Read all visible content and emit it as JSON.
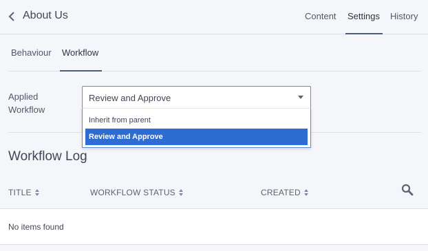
{
  "header": {
    "title": "About Us",
    "tabs": [
      {
        "label": "Content"
      },
      {
        "label": "Settings"
      },
      {
        "label": "History"
      }
    ],
    "active_tab": "Settings"
  },
  "settings_tabs": {
    "tabs": [
      {
        "label": "Behaviour"
      },
      {
        "label": "Workflow"
      }
    ],
    "active_tab": "Workflow"
  },
  "workflow": {
    "label": "Applied Workflow",
    "selected_value": "Review and Approve",
    "options": [
      {
        "label": "Inherit from parent"
      },
      {
        "label": "Review and Approve"
      }
    ]
  },
  "log": {
    "title": "Workflow Log",
    "columns": [
      {
        "label": "TITLE"
      },
      {
        "label": "WORKFLOW STATUS"
      },
      {
        "label": "CREATED"
      }
    ],
    "empty_message": "No items found"
  },
  "colors": {
    "accent": "#4d5b76",
    "selection": "#2d6cd0",
    "focus_border": "#5b8bd6",
    "icon": "#5a6478"
  },
  "icons": [
    "chevron-left-icon",
    "sort-icon",
    "search-icon",
    "caret-down-icon"
  ]
}
